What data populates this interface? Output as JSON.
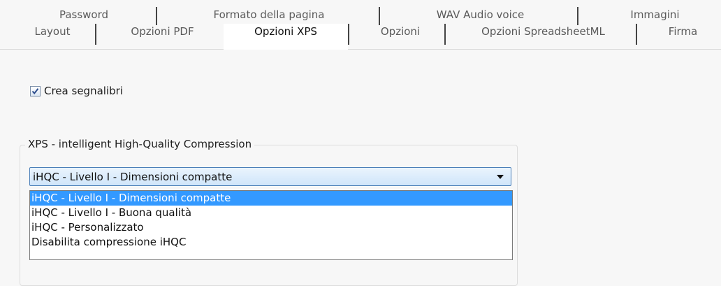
{
  "tabs": {
    "top": [
      "Password",
      "Formato della pagina",
      "WAV Audio voice",
      "Immagini"
    ],
    "bottom": [
      "Layout",
      "Opzioni PDF",
      "Opzioni XPS",
      "Opzioni",
      "Opzioni SpreadsheetML",
      "Firma"
    ],
    "active": "Opzioni XPS"
  },
  "checkbox": {
    "label": "Crea segnalibri",
    "checked": true
  },
  "compression": {
    "group_title": "XPS - intelligent High-Quality Compression",
    "selected": "iHQC - Livello I - Dimensioni compatte",
    "options": [
      "iHQC - Livello I - Dimensioni compatte",
      "iHQC - Livello I - Buona qualità",
      "iHQC - Personalizzato",
      "Disabilita compressione iHQC"
    ]
  },
  "colors": {
    "selection": "#3399ff",
    "background": "#f7f7f7"
  },
  "icons": {
    "dropdown": "chevron-down-icon",
    "check": "checkmark-icon"
  }
}
